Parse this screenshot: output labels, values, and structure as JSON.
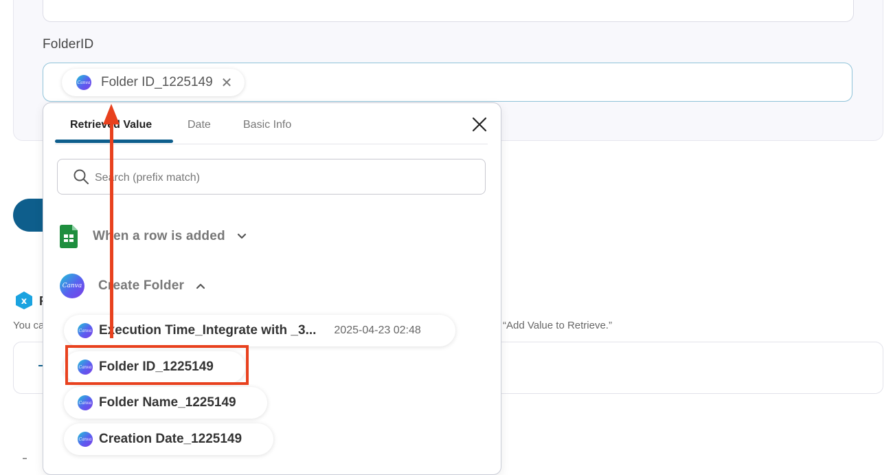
{
  "form": {
    "field_label": "FolderID",
    "chip_text": "Folder ID_1225149",
    "chip_remove": "✕"
  },
  "background": {
    "section_initial": "R",
    "help_text_left": "You ca",
    "help_text_right": "“Add Value to Retrieve.”"
  },
  "popup": {
    "tabs": [
      {
        "label": "Retrieved Value"
      },
      {
        "label": "Date"
      },
      {
        "label": "Basic Info"
      }
    ],
    "search_placeholder": "Search (prefix match)",
    "groups": [
      {
        "label": "When a row is added",
        "icon": "google-sheets-icon",
        "state": "collapsed"
      },
      {
        "label": "Create Folder",
        "icon": "canva-icon",
        "state": "expanded"
      }
    ],
    "items": [
      {
        "label": "Execution Time_Integrate with _3...",
        "value": "2025-04-23 02:48"
      },
      {
        "label": "Folder ID_1225149",
        "value": ""
      },
      {
        "label": "Folder Name_1225149",
        "value": ""
      },
      {
        "label": "Creation Date_1225149",
        "value": ""
      }
    ]
  },
  "brand": {
    "canva_text": "Canva",
    "accent": "#0e5e8c",
    "annotation": "#e8411e",
    "sheets_green": "#1e8e3e"
  }
}
